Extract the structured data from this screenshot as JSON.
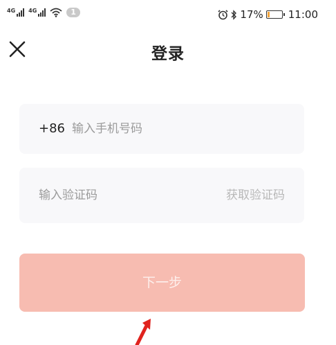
{
  "status_bar": {
    "signal1_label": "4G",
    "signal2_label": "4G",
    "notification_count": "1",
    "battery_percent": "17%",
    "battery_level": 0.17,
    "time": "11:00"
  },
  "header": {
    "title": "登录"
  },
  "phone_field": {
    "country_code": "+86",
    "placeholder": "输入手机号码"
  },
  "code_field": {
    "placeholder": "输入验证码",
    "get_code_label": "获取验证码"
  },
  "next_button": {
    "label": "下一步"
  },
  "colors": {
    "button_bg": "#f7bcb1",
    "field_bg": "#f8f8fa",
    "arrow": "#e0231e",
    "battery_fill": "#f2a43a"
  }
}
